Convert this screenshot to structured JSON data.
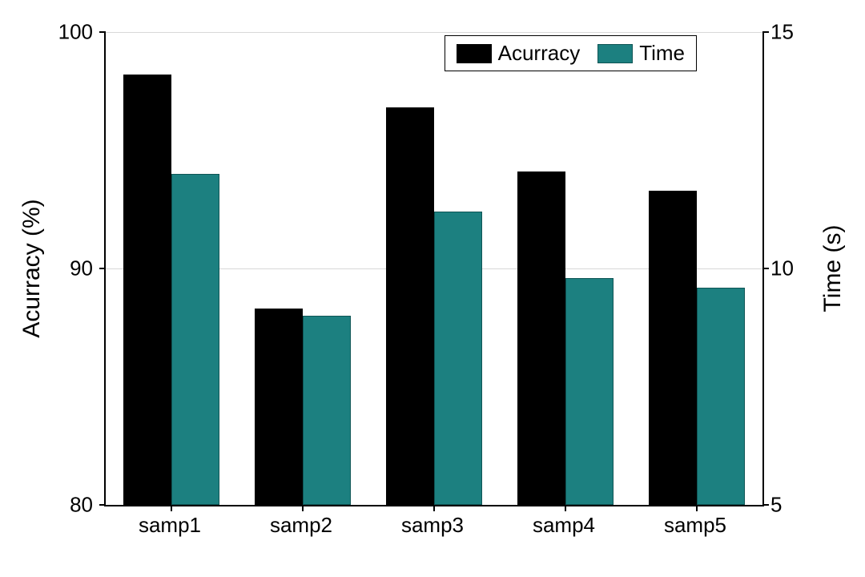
{
  "chart_data": {
    "type": "bar",
    "categories": [
      "samp1",
      "samp2",
      "samp3",
      "samp4",
      "samp5"
    ],
    "series": [
      {
        "name": "Acurracy",
        "axis": "left",
        "values": [
          98.2,
          88.3,
          96.8,
          94.1,
          93.3
        ]
      },
      {
        "name": "Time",
        "axis": "right",
        "values": [
          12.0,
          9.0,
          11.2,
          9.8,
          9.6
        ]
      }
    ],
    "ylabel_left": "Acurracy (%)",
    "ylabel_right": "Time (s)",
    "ylim_left": [
      80,
      100
    ],
    "ylim_right": [
      5,
      15
    ],
    "yticks_left": [
      80,
      90,
      100
    ],
    "yticks_right": [
      5,
      10,
      15
    ],
    "legend_position": "top-right",
    "grid": "horizontal",
    "colors": {
      "Acurracy": "#000000",
      "Time": "#1c8080"
    }
  }
}
